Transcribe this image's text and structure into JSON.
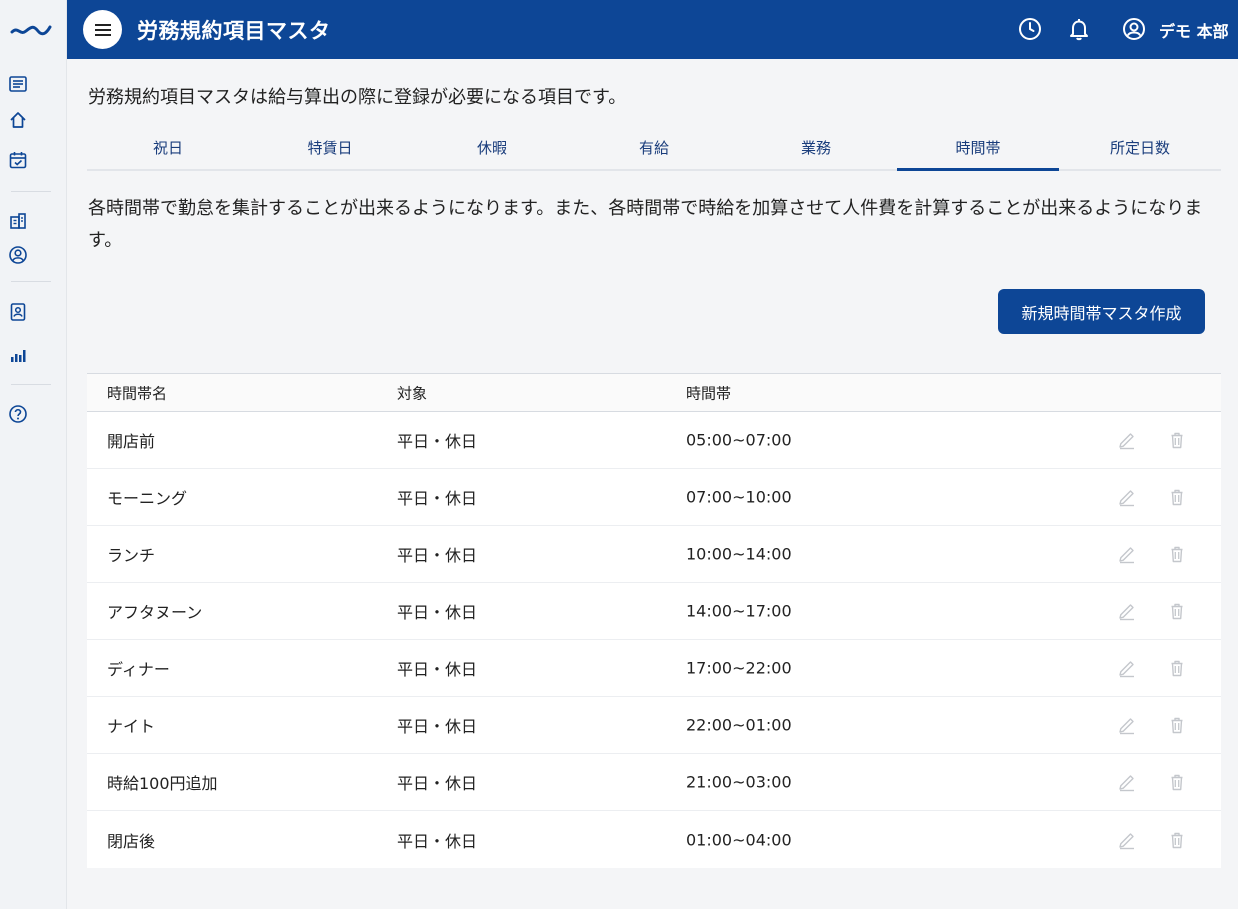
{
  "header": {
    "title": "労務規約項目マスタ",
    "user_name": "デモ 本部"
  },
  "description": "労務規約項目マスタは給与算出の際に登録が必要になる項目です。",
  "tabs": [
    {
      "label": "祝日"
    },
    {
      "label": "特賃日"
    },
    {
      "label": "休暇"
    },
    {
      "label": "有給"
    },
    {
      "label": "業務"
    },
    {
      "label": "時間帯",
      "active": true
    },
    {
      "label": "所定日数"
    }
  ],
  "section_description": "各時間帯で勤怠を集計することが出来るようになります。また、各時間帯で時給を加算させて人件費を計算することが出来るようになります。",
  "create_button_label": "新規時間帯マスタ作成",
  "table": {
    "columns": [
      "時間帯名",
      "対象",
      "時間帯"
    ],
    "rows": [
      {
        "name": "開店前",
        "target": "平日・休日",
        "time": "05:00~07:00"
      },
      {
        "name": "モーニング",
        "target": "平日・休日",
        "time": "07:00~10:00"
      },
      {
        "name": "ランチ",
        "target": "平日・休日",
        "time": "10:00~14:00"
      },
      {
        "name": "アフタヌーン",
        "target": "平日・休日",
        "time": "14:00~17:00"
      },
      {
        "name": "ディナー",
        "target": "平日・休日",
        "time": "17:00~22:00"
      },
      {
        "name": "ナイト",
        "target": "平日・休日",
        "time": "22:00~01:00"
      },
      {
        "name": "時給100円追加",
        "target": "平日・休日",
        "time": "21:00~03:00"
      },
      {
        "name": "閉店後",
        "target": "平日・休日",
        "time": "01:00~04:00"
      }
    ]
  },
  "colors": {
    "brand": "#0d4696",
    "icon": "#1a3d7c",
    "action_icon": "#c4c7cc"
  },
  "sidebar_icons": [
    "list-icon",
    "home-icon",
    "calendar-check-icon",
    "building-icon",
    "user-circle-icon",
    "id-badge-icon",
    "bar-chart-icon",
    "help-icon"
  ],
  "header_icons": [
    "clock-icon",
    "bell-icon",
    "user-icon"
  ]
}
